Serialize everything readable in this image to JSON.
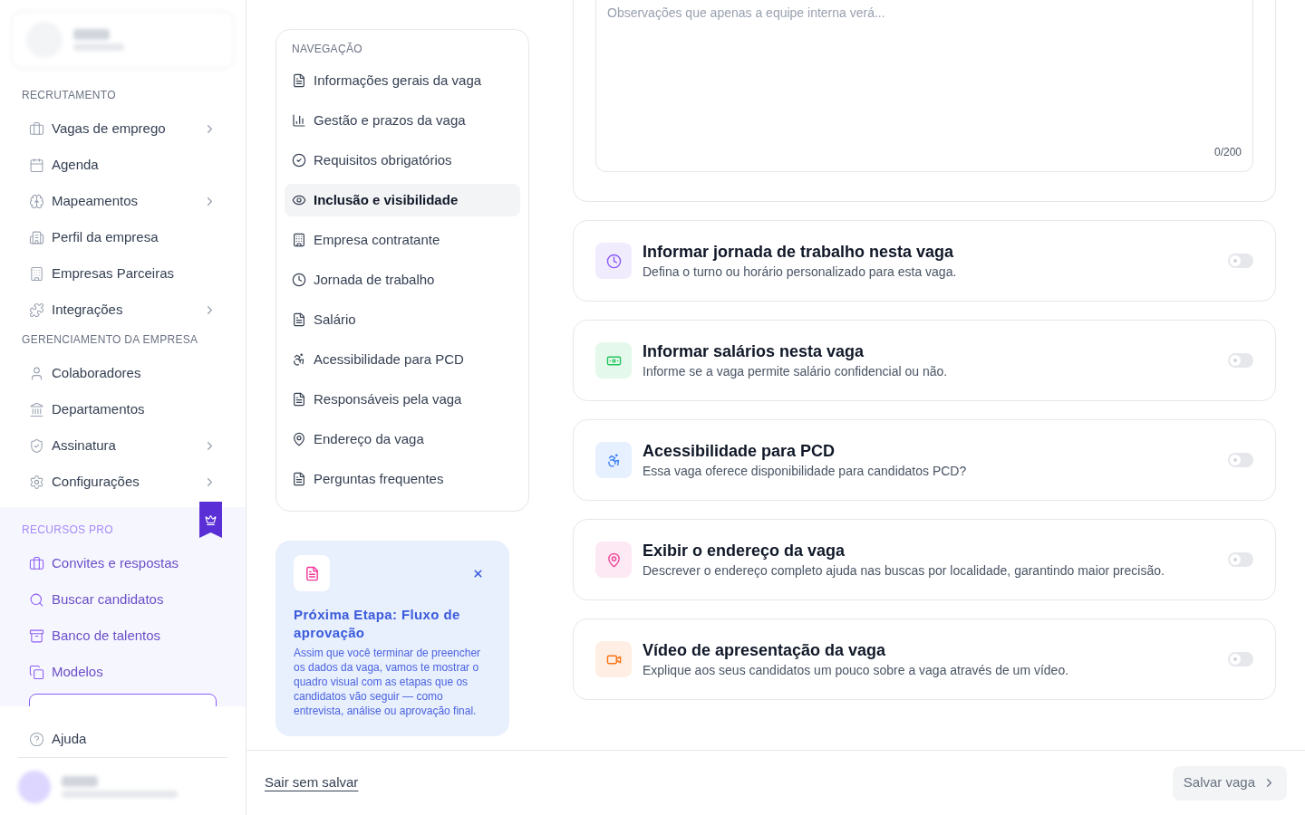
{
  "sidebar": {
    "sections": [
      {
        "title": "RECRUTAMENTO",
        "pro": false,
        "items": [
          {
            "label": "Vagas de emprego",
            "expandable": true
          },
          {
            "label": "Agenda",
            "expandable": false
          },
          {
            "label": "Mapeamentos",
            "expandable": true
          },
          {
            "label": "Perfil da empresa",
            "expandable": false
          },
          {
            "label": "Empresas Parceiras",
            "expandable": false
          },
          {
            "label": "Integrações",
            "expandable": true
          }
        ]
      },
      {
        "title": "GERENCIAMENTO DA EMPRESA",
        "pro": false,
        "items": [
          {
            "label": "Colaboradores",
            "expandable": false
          },
          {
            "label": "Departamentos",
            "expandable": false
          },
          {
            "label": "Assinatura",
            "expandable": true
          },
          {
            "label": "Configurações",
            "expandable": true
          }
        ]
      },
      {
        "title": "RECURSOS PRO",
        "pro": true,
        "items": [
          {
            "label": "Convites e respostas",
            "expandable": false
          },
          {
            "label": "Buscar candidatos",
            "expandable": false
          },
          {
            "label": "Banco de talentos",
            "expandable": false
          },
          {
            "label": "Modelos",
            "expandable": false
          }
        ]
      }
    ],
    "help": "Ajuda"
  },
  "nav": {
    "title": "NAVEGAÇÃO",
    "items": [
      {
        "label": "Informações gerais da vaga",
        "selected": false
      },
      {
        "label": "Gestão e prazos da vaga",
        "selected": false
      },
      {
        "label": "Requisitos obrigatórios",
        "selected": false
      },
      {
        "label": "Inclusão e visibilidade",
        "selected": true
      },
      {
        "label": "Empresa contratante",
        "selected": false
      },
      {
        "label": "Jornada de trabalho",
        "selected": false
      },
      {
        "label": "Salário",
        "selected": false
      },
      {
        "label": "Acessibilidade para PCD",
        "selected": false
      },
      {
        "label": "Responsáveis pela vaga",
        "selected": false
      },
      {
        "label": "Endereço da vaga",
        "selected": false
      },
      {
        "label": "Perguntas frequentes",
        "selected": false
      }
    ]
  },
  "info_card": {
    "title": "Próxima Etapa: Fluxo de aprovação",
    "body": "Assim que você terminar de preencher os dados da vaga, vamos te mostrar o quadro visual com as etapas que os candidatos vão seguir — como entrevista, análise ou aprovação final."
  },
  "notes_field": {
    "placeholder": "Observações que apenas a equipe interna verá...",
    "counter": "0/200"
  },
  "options": [
    {
      "title": "Informar jornada de trabalho nesta vaga",
      "description": "Defina o turno ou horário personalizado para esta vaga.",
      "on": false,
      "color": "#8b5cf6"
    },
    {
      "title": "Informar salários nesta vaga",
      "description": "Informe se a vaga permite salário confidencial ou não.",
      "on": false,
      "color": "#22c55e"
    },
    {
      "title": "Acessibilidade para PCD",
      "description": "Essa vaga oferece disponibilidade para candidatos PCD?",
      "on": false,
      "color": "#3b82f6"
    },
    {
      "title": "Exibir o endereço da vaga",
      "description": "Descrever o endereço completo ajuda nas buscas por localidade, garantindo maior precisão.",
      "on": false,
      "color": "#ec4899"
    },
    {
      "title": "Vídeo de apresentação da vaga",
      "description": "Explique aos seus candidatos um pouco sobre a vaga através de um vídeo.",
      "on": false,
      "color": "#f97316"
    }
  ],
  "footer": {
    "exit_link": "Sair sem salvar",
    "save_button": {
      "label": "Salvar vaga",
      "disabled": true
    }
  }
}
